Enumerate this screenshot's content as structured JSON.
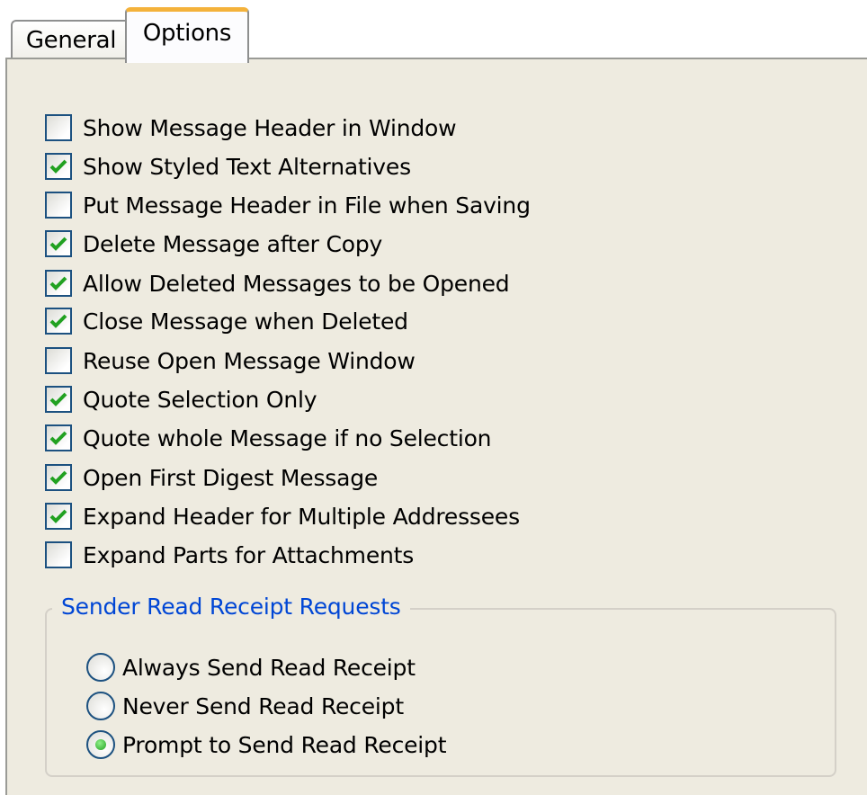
{
  "tabs": [
    {
      "label": "General",
      "active": false
    },
    {
      "label": "Options",
      "active": true
    }
  ],
  "options": [
    {
      "label": "Show Message Header in Window",
      "checked": false
    },
    {
      "label": "Show Styled Text Alternatives",
      "checked": true
    },
    {
      "label": "Put Message Header in File when Saving",
      "checked": false
    },
    {
      "label": "Delete Message after Copy",
      "checked": true
    },
    {
      "label": "Allow Deleted Messages to be Opened",
      "checked": true
    },
    {
      "label": "Close Message when Deleted",
      "checked": true
    },
    {
      "label": "Reuse Open Message Window",
      "checked": false
    },
    {
      "label": "Quote Selection Only",
      "checked": true
    },
    {
      "label": "Quote whole Message if no Selection",
      "checked": true
    },
    {
      "label": "Open First Digest Message",
      "checked": true
    },
    {
      "label": "Expand Header for Multiple Addressees",
      "checked": true
    },
    {
      "label": "Expand Parts for Attachments",
      "checked": false
    }
  ],
  "receipt_group": {
    "title": "Sender Read Receipt Requests",
    "options": [
      {
        "label": "Always Send Read Receipt",
        "selected": false
      },
      {
        "label": "Never Send Read Receipt",
        "selected": false
      },
      {
        "label": "Prompt to Send Read Receipt",
        "selected": true
      }
    ]
  },
  "colors": {
    "panel_bg": "#eeebe0",
    "active_tab_accent": "#f4b23b",
    "checkmark": "#21a121",
    "group_title": "#0046d5",
    "control_border": "#1c5180"
  }
}
